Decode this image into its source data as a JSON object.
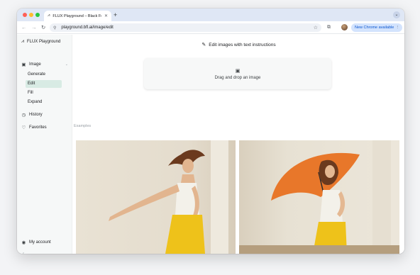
{
  "browser": {
    "tab_title": "FLUX Playground – Black Forest Labs",
    "url": "playground.bfl.ai/image/edit",
    "update_button": "New Chrome available"
  },
  "sidebar": {
    "brand": "FLUX Playground",
    "image_section": "Image",
    "sub_items": [
      {
        "label": "Generate",
        "active": false
      },
      {
        "label": "Edit",
        "active": true
      },
      {
        "label": "Fill",
        "active": false
      },
      {
        "label": "Expand",
        "active": false
      }
    ],
    "history": "History",
    "favorites": "Favorites",
    "account": "My account"
  },
  "main": {
    "heading": "Edit images with text instructions",
    "dropzone_text": "Drag and drop an image",
    "examples_label": "Examples"
  },
  "icons": {
    "brand": "flux-logo-icon",
    "image": "image-icon",
    "history": "clock-icon",
    "favorites": "heart-icon",
    "account": "user-circle-icon",
    "edit": "magic-wand-icon",
    "upload": "image-upload-icon"
  },
  "colors": {
    "active_nav": "#d8ebe4",
    "sidebar_bg": "#f6f8f8",
    "update_pill": "#d3e3fd"
  }
}
